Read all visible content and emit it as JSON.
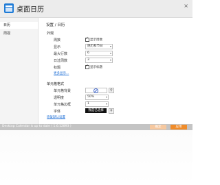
{
  "window": {
    "title": "桌面日历",
    "close_symbol": "×"
  },
  "sidebar": {
    "items": [
      {
        "label": "日历",
        "active": true
      },
      {
        "label": "周视"
      }
    ]
  },
  "breadcrumb": "设置 / 日历",
  "appearance": {
    "section_label": "外观",
    "rows": [
      {
        "label": "周数",
        "checkbox_label": "显示周数",
        "checked": true
      },
      {
        "label": "显示",
        "value": "阴历和节日"
      },
      {
        "label": "最大行数",
        "value": "6"
      },
      {
        "label": "日过周数",
        "value": "3"
      },
      {
        "label": "标题",
        "checkbox_label": "显示标题",
        "checked": true
      }
    ],
    "link": "更多显示..."
  },
  "note_style": {
    "section_label": "单元格格式",
    "rows": [
      {
        "label": "单元格背景"
      },
      {
        "label": "透明度",
        "value": "50%"
      },
      {
        "label": "单元格边框",
        "value": "1"
      },
      {
        "label": "字体",
        "value": "我是已选择"
      }
    ],
    "link": "恢复默认设置"
  },
  "status": {
    "text": "Desktop Calendar is up to date ( 1.6.12893 )",
    "button_ok": "确定",
    "button_ok_color": "#f6c89f",
    "button_apply": "应用",
    "button_apply_color": "#f08c2a",
    "bar_color": "#c4c4c4"
  }
}
